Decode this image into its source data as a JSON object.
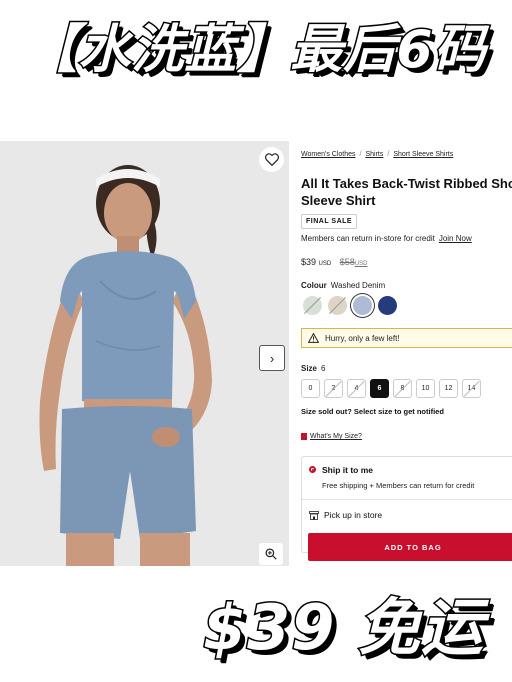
{
  "overlay": {
    "top_text": "【水洗蓝】最后6码",
    "bottom_text": "$39 免运"
  },
  "gallery": {
    "wishlist_icon": "heart-icon",
    "next_icon": "chevron-right-icon",
    "next_glyph": "›",
    "zoom_icon": "zoom-icon"
  },
  "breadcrumb": {
    "items": [
      "Women's Clothes",
      "Shirts",
      "Short Sleeve Shirts"
    ],
    "separator": "/"
  },
  "product": {
    "title": "All It Takes Back-Twist Ribbed Short-Sleeve Shirt",
    "badge": "FINAL SALE",
    "members_text": "Members can return in-store for credit",
    "members_link": "Join Now",
    "price": "$39",
    "price_currency": "USD",
    "old_price": "$58",
    "old_currency": "USD"
  },
  "colour": {
    "label": "Colour",
    "selected": "Washed Denim",
    "swatches": [
      {
        "color": "#d6e0d4",
        "sold_out": true
      },
      {
        "color": "#ddd5c6",
        "sold_out": true
      },
      {
        "color": "#aebad6",
        "selected": true
      },
      {
        "color": "#263c7a"
      }
    ]
  },
  "alert": {
    "icon": "warning-icon",
    "text": "Hurry, only a few left!"
  },
  "size": {
    "label": "Size",
    "selected": "6",
    "options": [
      {
        "label": "0"
      },
      {
        "label": "2",
        "sold_out": true
      },
      {
        "label": "4",
        "sold_out": true
      },
      {
        "label": "6",
        "selected": true
      },
      {
        "label": "8",
        "sold_out": true
      },
      {
        "label": "10"
      },
      {
        "label": "12"
      },
      {
        "label": "14",
        "sold_out": true
      }
    ],
    "sold_out_text": "Size sold out? Select size to get notified",
    "guide_link": "What's My Size?"
  },
  "shipping": {
    "option1_label": "Ship it to me",
    "option1_sub": "Free shipping + Members can return for credit",
    "option2_label": "Pick up in store"
  },
  "cta": {
    "add_to_bag": "ADD TO BAG"
  },
  "colors": {
    "accent": "#c8102e"
  }
}
